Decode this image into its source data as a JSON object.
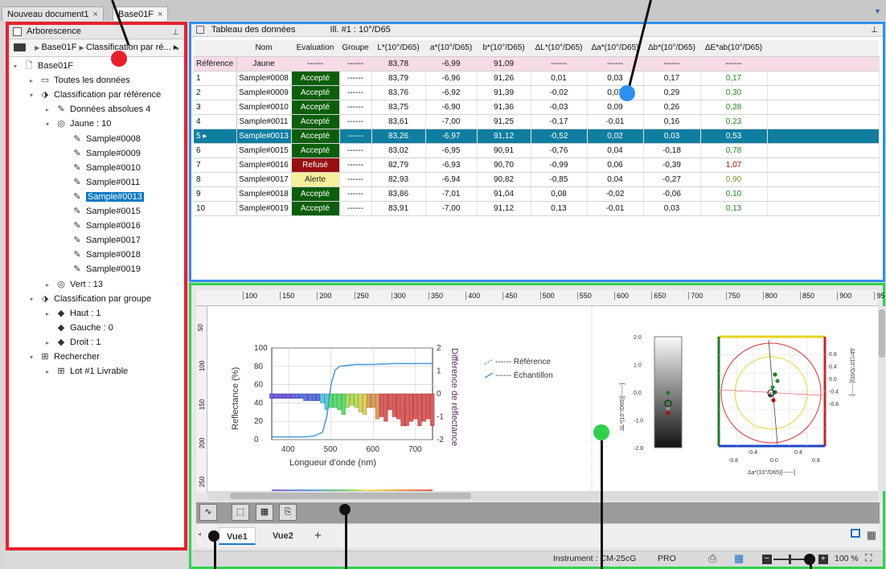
{
  "tabs": {
    "doc1": "Nouveau document1",
    "doc2": "Base01F",
    "close": "×"
  },
  "left": {
    "title": "Arborescence",
    "path": [
      "Base01F",
      "Classification par ré...",
      "▸"
    ],
    "tree": [
      {
        "label": "Base01F",
        "icon": "document-icon",
        "indent": 0,
        "toggle": "▾"
      },
      {
        "label": "Toutes les données",
        "icon": "database-icon",
        "indent": 1,
        "toggle": "▸"
      },
      {
        "label": "Classification par référence",
        "icon": "classification-icon",
        "indent": 1,
        "toggle": "▾"
      },
      {
        "label": "Données absolues 4",
        "icon": "sample-icon",
        "indent": 2,
        "toggle": "▸"
      },
      {
        "label": "Jaune : 10",
        "icon": "target-icon",
        "indent": 2,
        "toggle": "▾"
      },
      {
        "label": "Sample#0008",
        "icon": "sample-icon",
        "indent": 3
      },
      {
        "label": "Sample#0009",
        "icon": "sample-icon",
        "indent": 3
      },
      {
        "label": "Sample#0010",
        "icon": "sample-icon",
        "indent": 3
      },
      {
        "label": "Sample#0011",
        "icon": "sample-icon",
        "indent": 3
      },
      {
        "label": "Sample#0013",
        "icon": "sample-icon",
        "indent": 3,
        "selected": true
      },
      {
        "label": "Sample#0015",
        "icon": "sample-icon",
        "indent": 3
      },
      {
        "label": "Sample#0016",
        "icon": "sample-icon",
        "indent": 3
      },
      {
        "label": "Sample#0017",
        "icon": "sample-icon",
        "indent": 3
      },
      {
        "label": "Sample#0018",
        "icon": "sample-icon",
        "indent": 3
      },
      {
        "label": "Sample#0019",
        "icon": "sample-icon",
        "indent": 3
      },
      {
        "label": "Vert : 13",
        "icon": "target-icon",
        "indent": 2,
        "toggle": "▸"
      },
      {
        "label": "Classification par groupe",
        "icon": "classification-icon",
        "indent": 1,
        "toggle": "▾"
      },
      {
        "label": "Haut : 1",
        "icon": "group-icon",
        "indent": 2,
        "toggle": "▸"
      },
      {
        "label": "Gauche : 0",
        "icon": "group-icon",
        "indent": 2
      },
      {
        "label": "Droit : 1",
        "icon": "group-icon",
        "indent": 2,
        "toggle": "▸"
      },
      {
        "label": "Rechercher",
        "icon": "search-tree-icon",
        "indent": 1,
        "toggle": "▾"
      },
      {
        "label": "Lot #1 Livrable",
        "icon": "search-tree-icon",
        "indent": 2,
        "toggle": "▸"
      }
    ]
  },
  "table": {
    "title": "Tableau des données",
    "ill": "Ill. #1 : 10°/D65",
    "columns": [
      "",
      "Nom",
      "Evaluation",
      "Groupe",
      "L*(10°/D65)",
      "a*(10°/D65)",
      "b*(10°/D65)",
      "ΔL*(10°/D65)",
      "Δa*(10°/D65)",
      "Δb*(10°/D65)",
      "ΔE*ab(10°/D65)"
    ],
    "ref": [
      "Référence",
      "Jaune",
      "------",
      "------",
      "83,78",
      "-6,99",
      "91,09",
      "------",
      "------",
      "------",
      "------"
    ],
    "rows": [
      [
        "1",
        "Sample#0008",
        "Accepté",
        "------",
        "83,79",
        "-6,96",
        "91,26",
        "0,01",
        "0,03",
        "0,17",
        "0,17",
        "ok",
        "g"
      ],
      [
        "2",
        "Sample#0009",
        "Accepté",
        "------",
        "83,76",
        "-6,92",
        "91,39",
        "-0,02",
        "0,07",
        "0,29",
        "0,30",
        "ok",
        "g"
      ],
      [
        "3",
        "Sample#0010",
        "Accepté",
        "------",
        "83,75",
        "-6,90",
        "91,36",
        "-0,03",
        "0,09",
        "0,26",
        "0,28",
        "ok",
        "g"
      ],
      [
        "4",
        "Sample#0011",
        "Accepté",
        "------",
        "83,61",
        "-7,00",
        "91,25",
        "-0,17",
        "-0,01",
        "0,16",
        "0,23",
        "ok",
        "g"
      ],
      [
        "5 ▸",
        "Sample#0013",
        "Accepté",
        "------",
        "83,26",
        "-6,97",
        "91,12",
        "-0,52",
        "0,02",
        "0,03",
        "0,53",
        "ok",
        "g"
      ],
      [
        "6",
        "Sample#0015",
        "Accepté",
        "------",
        "83,02",
        "-6,95",
        "90,91",
        "-0,76",
        "0,04",
        "-0,18",
        "0,78",
        "ok",
        "g"
      ],
      [
        "7",
        "Sample#0016",
        "Refusé",
        "------",
        "82,79",
        "-6,93",
        "90,70",
        "-0,99",
        "0,06",
        "-0,39",
        "1,07",
        "no",
        "r"
      ],
      [
        "8",
        "Sample#0017",
        "Alerte",
        "------",
        "82,93",
        "-6,94",
        "90,82",
        "-0,85",
        "0,04",
        "-0,27",
        "0,90",
        "al",
        "y"
      ],
      [
        "9",
        "Sample#0018",
        "Accepté",
        "------",
        "83,86",
        "-7,01",
        "91,04",
        "0,08",
        "-0,02",
        "-0,06",
        "0,10",
        "ok",
        "g"
      ],
      [
        "10",
        "Sample#0019",
        "Accepté",
        "------",
        "83,91",
        "-7,00",
        "91,12",
        "0,13",
        "-0,01",
        "0,03",
        "0,13",
        "ok",
        "g"
      ]
    ]
  },
  "ruler": {
    "ticks": [
      "100",
      "150",
      "200",
      "250",
      "300",
      "350",
      "400",
      "450",
      "500",
      "550",
      "600",
      "650",
      "700",
      "750",
      "800",
      "850",
      "900",
      "95"
    ],
    "vticks": [
      "50",
      "100",
      "150",
      "200",
      "250"
    ]
  },
  "spectral": {
    "ylabel": "Reflectance (%)",
    "y2label": "Différence de réflectance",
    "xlabel": "Longueur d'onde (nm)",
    "yticks": [
      "100",
      "80",
      "60",
      "40",
      "20",
      "0"
    ],
    "y2ticks": [
      "2",
      "1",
      "0",
      "-1",
      "-2"
    ],
    "xticks": [
      "400",
      "500",
      "600",
      "700"
    ],
    "legend": [
      "------ Référence",
      "------ Échantillon"
    ]
  },
  "lchart": {
    "label": "ΔL*(10°/D65)[------]",
    "ticks": [
      "2.0",
      "1.0",
      "0.0",
      "-1.0",
      "-2.0"
    ]
  },
  "abchart": {
    "xlabel": "Δa*(10°/D65)[------]",
    "ylabel": "Δb*(10°/D65)[------]",
    "yticks": [
      "0.8",
      "0.4",
      "0.0",
      "-0.4",
      "-0.8"
    ],
    "xticks1": [
      "-0.4",
      "0.4"
    ],
    "xticks2": [
      "-0.8",
      "0.0",
      "0.8"
    ]
  },
  "views": {
    "v1": "Vue1",
    "v2": "Vue2",
    "add": "+"
  },
  "status": {
    "instrument": "Instrument : CM-25cG",
    "pro": "PRO",
    "zoom": "100 %"
  },
  "chart_data": [
    {
      "type": "line",
      "xlabel": "Longueur d'onde (nm)",
      "ylabel": "Reflectance (%)",
      "xlim": [
        360,
        740
      ],
      "ylim": [
        0,
        100
      ],
      "series": [
        {
          "name": "Référence",
          "x": [
            360,
            400,
            440,
            460,
            480,
            490,
            500,
            510,
            520,
            540,
            560,
            600,
            650,
            700,
            740
          ],
          "y": [
            3,
            3,
            3,
            4,
            8,
            25,
            60,
            76,
            80,
            81,
            82,
            82,
            83,
            83,
            83
          ]
        },
        {
          "name": "Échantillon",
          "x": [
            360,
            400,
            440,
            460,
            480,
            490,
            500,
            510,
            520,
            540,
            560,
            600,
            650,
            700,
            740
          ],
          "y": [
            3,
            3,
            3,
            4,
            8,
            25,
            60,
            76,
            80,
            81,
            82,
            82,
            83,
            83,
            83
          ]
        }
      ]
    },
    {
      "type": "bar",
      "ylabel": "Différence de réflectance",
      "ylim": [
        -2,
        2
      ],
      "x": [
        360,
        370,
        380,
        390,
        400,
        410,
        420,
        430,
        440,
        450,
        460,
        470,
        480,
        490,
        500,
        510,
        520,
        530,
        540,
        550,
        560,
        570,
        580,
        590,
        600,
        610,
        620,
        630,
        640,
        650,
        660,
        670,
        680,
        690,
        700,
        710,
        720,
        730,
        740
      ],
      "values": [
        -0.2,
        -0.2,
        -0.2,
        -0.2,
        -0.2,
        -0.2,
        -0.2,
        -0.2,
        -0.3,
        -0.3,
        -0.3,
        -0.3,
        -0.4,
        -0.7,
        -0.6,
        -0.6,
        -0.7,
        -0.9,
        -0.6,
        -0.5,
        -0.6,
        -0.8,
        -0.9,
        -0.6,
        -0.6,
        -1.1,
        -1.0,
        -1.2,
        -0.7,
        -1.0,
        -1.1,
        -1.4,
        -1.4,
        -1.2,
        -1.1,
        -1.4,
        -1.2,
        -1.1,
        -1.4
      ]
    }
  ]
}
